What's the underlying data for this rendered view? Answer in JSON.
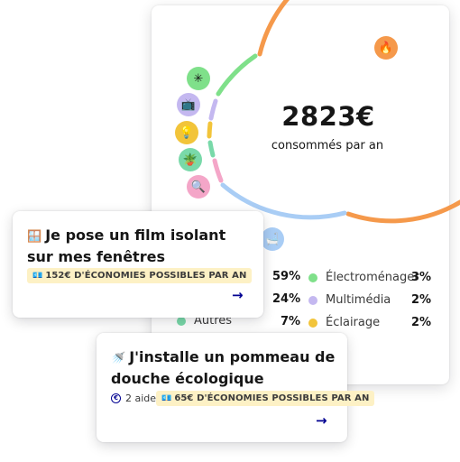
{
  "summary": {
    "total": "2823€",
    "caption": "consommés par an"
  },
  "colors": {
    "chauffage": "#f5994b",
    "eau_chaude": "#a9cdf5",
    "electromenager": "#7fe08a",
    "multimedia": "#c4b8f0",
    "eclairage": "#f2c43a",
    "autres": "#79d9a9",
    "cuisson": "#f4a6c8",
    "brand_blue": "#000091",
    "badge_bg": "#fdf1c5"
  },
  "icons": {
    "chauffage": "fire-icon",
    "eau_chaude": "bathtub-icon",
    "electromenager": "washing-machine-icon",
    "multimedia": "tv-icon",
    "eclairage": "lightbulb-icon",
    "autres": "plant-pot-icon",
    "cuisson": "magnifier-icon"
  },
  "legend": {
    "left": [
      {
        "pct": "59%"
      },
      {
        "pct": "24%"
      },
      {
        "label": "Autres",
        "pct": "7%"
      }
    ],
    "right": [
      {
        "label": "Électroménager",
        "pct": "3%"
      },
      {
        "label": "Multimédia",
        "pct": "2%"
      },
      {
        "label": "Éclairage",
        "pct": "2%"
      }
    ]
  },
  "actions": [
    {
      "title": "Je pose un film isolant sur mes fenêtres",
      "badge": "152€ D'ÉCONOMIES POSSIBLES PAR AN",
      "arrow": "→"
    },
    {
      "title": "J'installe un pommeau de douche écologique",
      "aids": "2 aides",
      "badge": "65€ D'ÉCONOMIES POSSIBLES PAR AN",
      "arrow": "→"
    }
  ]
}
